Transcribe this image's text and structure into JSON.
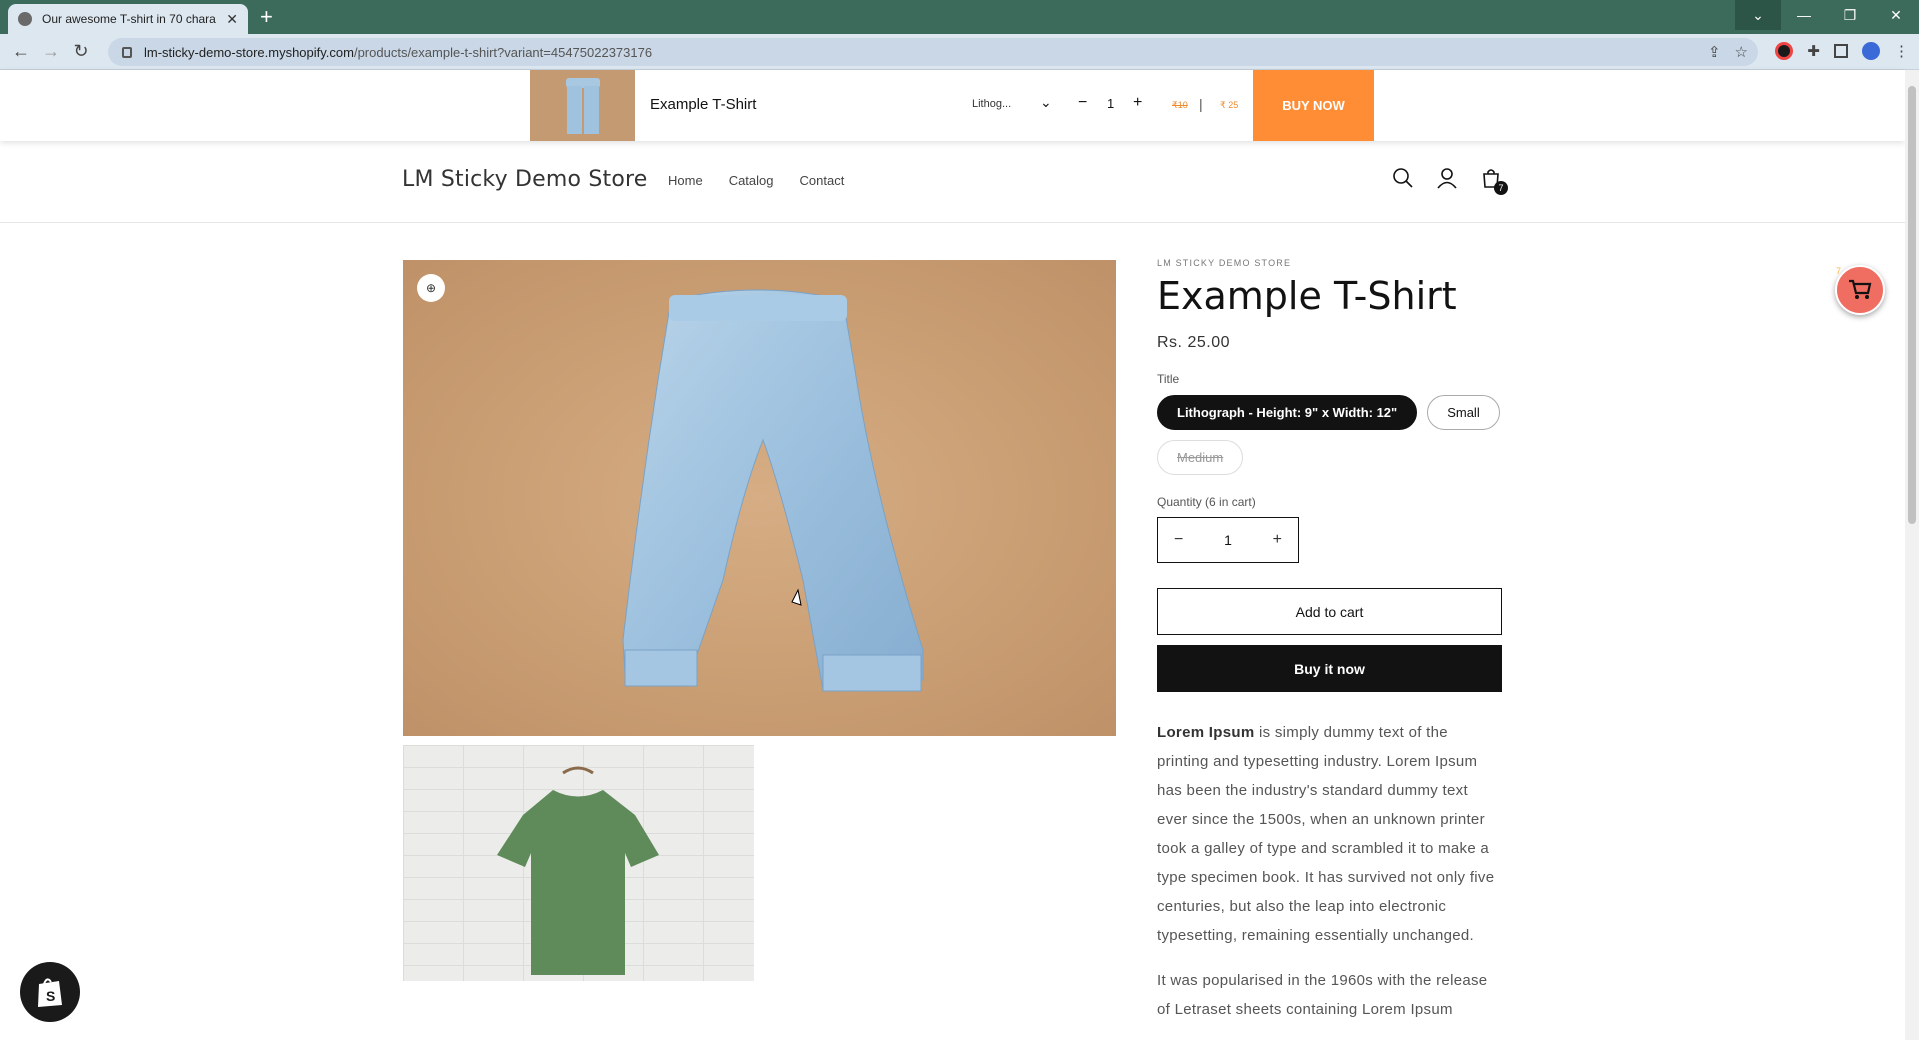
{
  "browser": {
    "tab_title": "Our awesome T-shirt in 70 chara",
    "tab_close": "✕",
    "new_tab": "+",
    "url_host": "lm-sticky-demo-store.myshopify.com",
    "url_path": "/products/example-t-shirt?variant=45475022373176",
    "window": {
      "dropdown": "⌄",
      "minimize": "—",
      "restore": "❐",
      "close": "✕"
    }
  },
  "sticky_bar": {
    "product_name": "Example T-Shirt",
    "variant": "Lithog...",
    "quantity": "1",
    "old_price": "₹10",
    "separator": "|",
    "new_price": "₹ 25",
    "buy_label": "BUY NOW",
    "accent": "#ff8d36"
  },
  "header": {
    "store_name": "LM Sticky Demo Store",
    "nav": [
      "Home",
      "Catalog",
      "Contact"
    ],
    "cart_count": "7"
  },
  "product": {
    "vendor": "LM STICKY DEMO STORE",
    "title": "Example T-Shirt",
    "price": "Rs. 25.00",
    "option_label": "Title",
    "options": [
      {
        "label": "Lithograph - Height: 9\" x Width: 12\"",
        "state": "selected"
      },
      {
        "label": "Small",
        "state": "available"
      },
      {
        "label": "Medium",
        "state": "unavailable"
      }
    ],
    "quantity_label": "Quantity (6 in cart)",
    "quantity": "1",
    "add_to_cart": "Add to cart",
    "buy_now": "Buy it now",
    "desc_bold": "Lorem Ipsum",
    "desc_p1": " is simply dummy text of the printing and typesetting industry. Lorem Ipsum has been the industry's standard dummy text ever since the 1500s, when an unknown printer took a galley of type and scrambled it to make a type specimen book. It has survived not only five centuries, but also the leap into electronic typesetting, remaining essentially unchanged.",
    "desc_p2": "It was popularised in the 1960s with the release of Letraset sheets containing Lorem Ipsum"
  },
  "floating_cart": {
    "count": "7",
    "color": "#f06d61"
  }
}
